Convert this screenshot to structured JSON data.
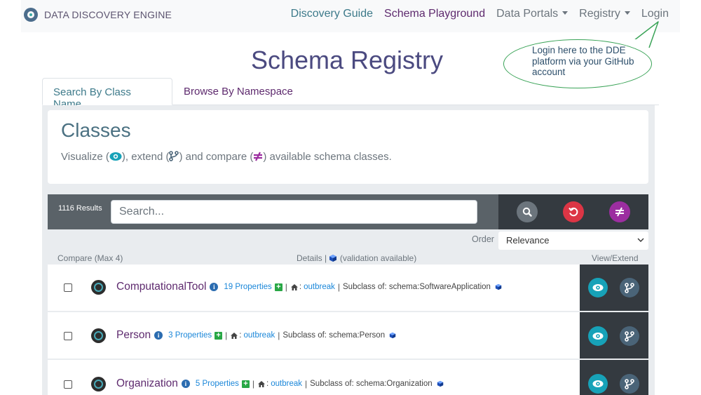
{
  "navbar": {
    "brand": "DATA DISCOVERY ENGINE",
    "links": [
      {
        "label": "Discovery Guide"
      },
      {
        "label": "Schema Playground"
      },
      {
        "label": "Data Portals"
      },
      {
        "label": "Registry"
      },
      {
        "label": "Login"
      }
    ]
  },
  "callout": {
    "text": "Login here to the DDE platform via your GitHub account",
    "border_color": "#3aa357"
  },
  "page": {
    "title": "Schema Registry"
  },
  "tabs": [
    {
      "label": "Search By Class Name",
      "active": true
    },
    {
      "label": "Browse By Namespace",
      "active": false
    }
  ],
  "hero": {
    "title": "Classes",
    "sub_part1": "Visualize (",
    "sub_part2": "), extend (",
    "sub_part3": ") and compare (",
    "sub_part4": ") available schema classes."
  },
  "search": {
    "results_count": "1116 Results",
    "placeholder": "Search...",
    "buttons": [
      {
        "icon": "search-icon",
        "color": "#6c757d"
      },
      {
        "icon": "reset-icon",
        "color": "#dc3545"
      },
      {
        "icon": "compare-icon",
        "color": "#9c2ea0"
      }
    ]
  },
  "order": {
    "label": "Order",
    "selected": "Relevance"
  },
  "columns": {
    "compare": "Compare (Max 4)",
    "details_prefix": "Details |",
    "details_suffix": "(validation available)",
    "view_extend": "View/Extend"
  },
  "rows": [
    {
      "name": "ComputationalTool",
      "info": "i",
      "properties": "19 Properties",
      "plus": "+",
      "ns_label": ":",
      "namespace": "outbreak",
      "subclass": "Subclass of: schema:SoftwareApplication"
    },
    {
      "name": "Person",
      "info": "i",
      "properties": "3 Properties",
      "plus": "+",
      "ns_label": ":",
      "namespace": "outbreak",
      "subclass": "Subclass of: schema:Person"
    },
    {
      "name": "Organization",
      "info": "i",
      "properties": "5 Properties",
      "plus": "+",
      "ns_label": ":",
      "namespace": "outbreak",
      "subclass": "Subclass of: schema:Organization"
    }
  ],
  "colors": {
    "primary_purple": "#5e2a6e",
    "teal": "#3d7a8a",
    "link_blue": "#1b87d9",
    "view_button": "#17a2b8",
    "dark_panel": "#343a40"
  }
}
